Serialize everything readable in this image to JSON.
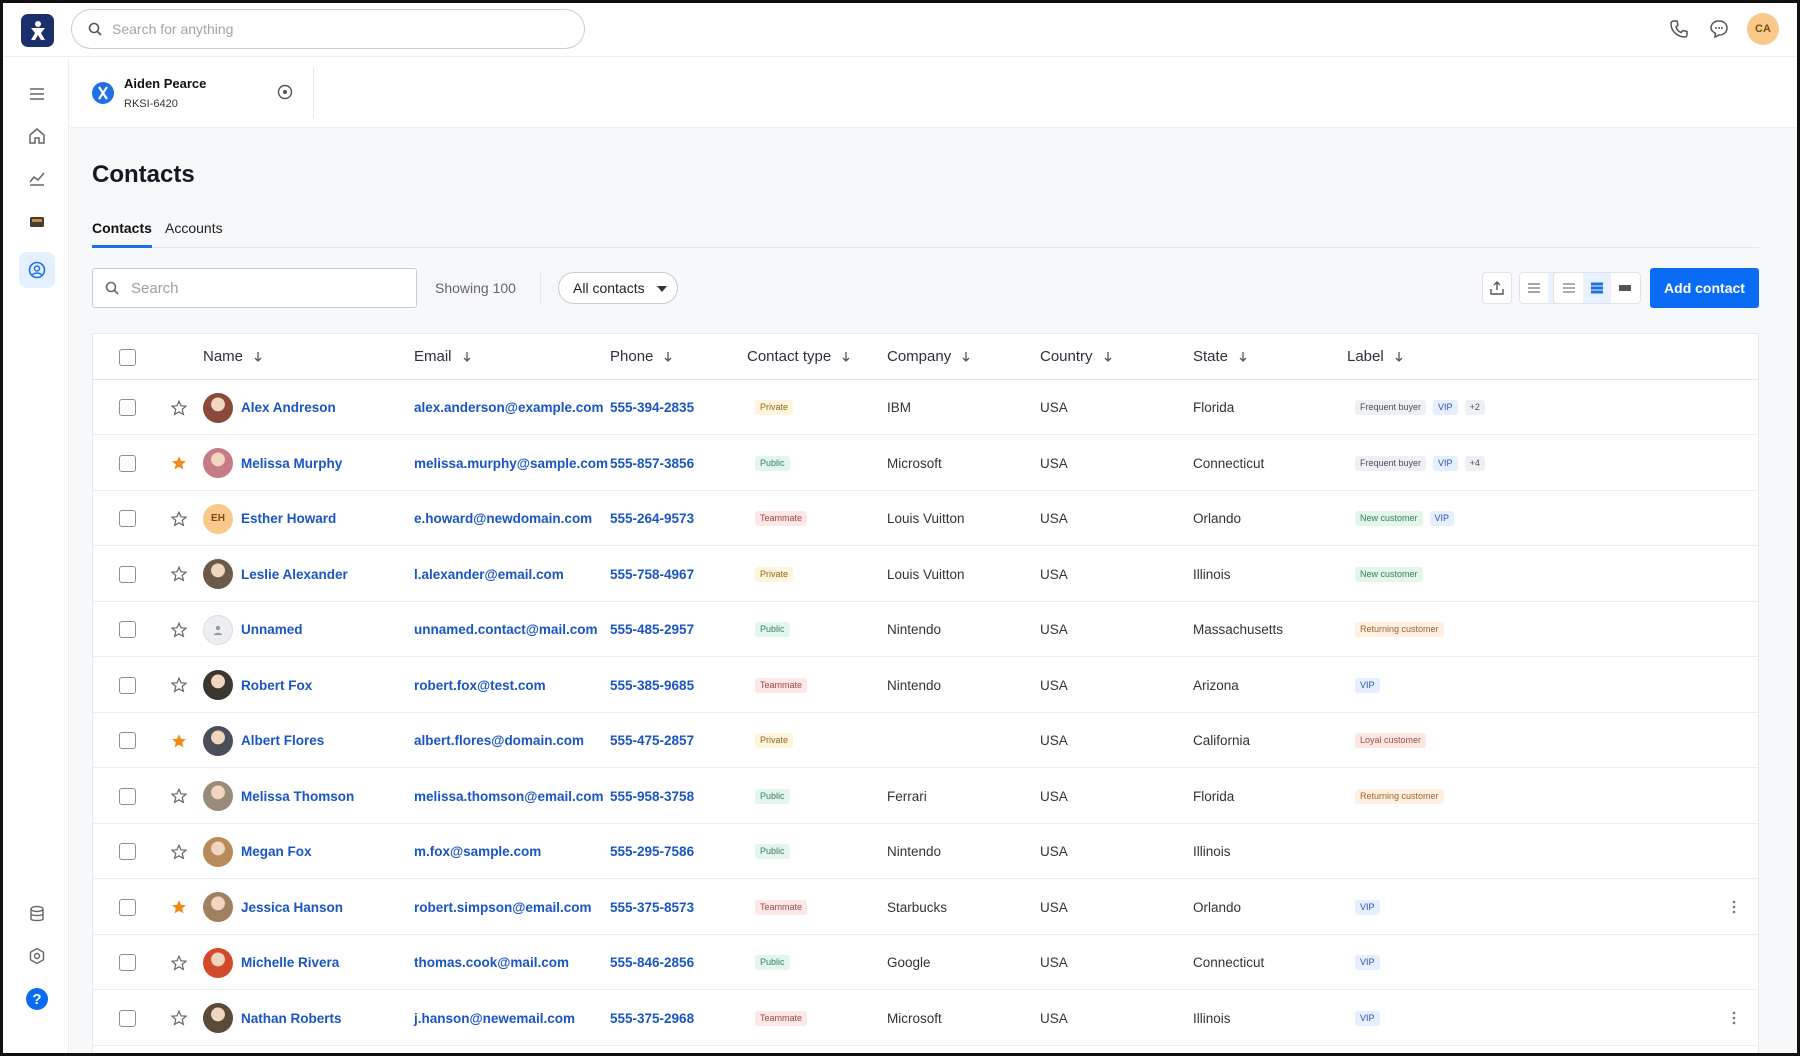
{
  "topbar": {
    "search_placeholder": "Search for anything",
    "user_initials": "CA"
  },
  "record": {
    "name": "Aiden Pearce",
    "id": "RKSI-6420"
  },
  "page": {
    "title": "Contacts",
    "tabs": [
      {
        "label": "Contacts",
        "active": true
      },
      {
        "label": "Accounts",
        "active": false
      }
    ]
  },
  "toolbar": {
    "search_placeholder": "Search",
    "showing": "Showing 100",
    "filter": "All contacts",
    "add_label": "Add contact"
  },
  "table": {
    "headers": [
      "Name",
      "Email",
      "Phone",
      "Contact type",
      "Company",
      "Country",
      "State",
      "Label"
    ],
    "rows": [
      {
        "starred": false,
        "avatar": "photo",
        "avatar_color": "#8a4a3a",
        "initials": "",
        "name": "Alex Andreson",
        "email": "alex.anderson@example.com",
        "phone": "555-394-2835",
        "type": "Private",
        "company": "IBM",
        "country": "USA",
        "state": "Florida",
        "labels": [
          {
            "text": "Frequent buyer",
            "style": "gray"
          },
          {
            "text": "VIP",
            "style": "vip"
          },
          {
            "text": "+2",
            "style": "gray"
          }
        ],
        "menu": false
      },
      {
        "starred": true,
        "avatar": "photo",
        "avatar_color": "#c77b86",
        "initials": "",
        "name": "Melissa Murphy",
        "email": "melissa.murphy@sample.com",
        "phone": "555-857-3856",
        "type": "Public",
        "company": "Microsoft",
        "country": "USA",
        "state": "Connecticut",
        "labels": [
          {
            "text": "Frequent buyer",
            "style": "gray"
          },
          {
            "text": "VIP",
            "style": "vip"
          },
          {
            "text": "+4",
            "style": "gray"
          }
        ],
        "menu": false
      },
      {
        "starred": false,
        "avatar": "initials",
        "avatar_color": "#f8c98b",
        "initials": "EH",
        "name": "Esther Howard",
        "email": "e.howard@newdomain.com",
        "phone": "555-264-9573",
        "type": "Teammate",
        "company": "Louis Vuitton",
        "country": "USA",
        "state": "Orlando",
        "labels": [
          {
            "text": "New customer",
            "style": "green"
          },
          {
            "text": "VIP",
            "style": "vip"
          }
        ],
        "menu": false
      },
      {
        "starred": false,
        "avatar": "photo",
        "avatar_color": "#6b5a4a",
        "initials": "",
        "name": "Leslie Alexander",
        "email": "l.alexander@email.com",
        "phone": "555-758-4967",
        "type": "Private",
        "company": "Louis Vuitton",
        "country": "USA",
        "state": "Illinois",
        "labels": [
          {
            "text": "New customer",
            "style": "green"
          }
        ],
        "menu": false
      },
      {
        "starred": false,
        "avatar": "placeholder",
        "avatar_color": "#eceef2",
        "initials": "",
        "name": "Unnamed",
        "email": "unnamed.contact@mail.com",
        "phone": "555-485-2957",
        "type": "Public",
        "company": "Nintendo",
        "country": "USA",
        "state": "Massachusetts",
        "labels": [
          {
            "text": "Returning customer",
            "style": "orange"
          }
        ],
        "menu": false
      },
      {
        "starred": false,
        "avatar": "photo",
        "avatar_color": "#3b3630",
        "initials": "",
        "name": "Robert Fox",
        "email": "robert.fox@test.com",
        "phone": "555-385-9685",
        "type": "Teammate",
        "company": "Nintendo",
        "country": "USA",
        "state": "Arizona",
        "labels": [
          {
            "text": "VIP",
            "style": "vip"
          }
        ],
        "menu": false
      },
      {
        "starred": true,
        "avatar": "photo",
        "avatar_color": "#4a4e58",
        "initials": "",
        "name": "Albert Flores",
        "email": "albert.flores@domain.com",
        "phone": "555-475-2857",
        "type": "Private",
        "company": "",
        "country": "USA",
        "state": "California",
        "labels": [
          {
            "text": "Loyal customer",
            "style": "red"
          }
        ],
        "menu": false
      },
      {
        "starred": false,
        "avatar": "photo",
        "avatar_color": "#9a8a7a",
        "initials": "",
        "name": "Melissa Thomson",
        "email": "melissa.thomson@email.com",
        "phone": "555-958-3758",
        "type": "Public",
        "company": "Ferrari",
        "country": "USA",
        "state": "Florida",
        "labels": [
          {
            "text": "Returning customer",
            "style": "orange"
          }
        ],
        "menu": false
      },
      {
        "starred": false,
        "avatar": "photo",
        "avatar_color": "#b98a5a",
        "initials": "",
        "name": "Megan Fox",
        "email": "m.fox@sample.com",
        "phone": "555-295-7586",
        "type": "Public",
        "company": "Nintendo",
        "country": "USA",
        "state": "Illinois",
        "labels": [],
        "menu": false
      },
      {
        "starred": true,
        "avatar": "photo",
        "avatar_color": "#a08060",
        "initials": "",
        "name": "Jessica Hanson",
        "email": "robert.simpson@email.com",
        "phone": "555-375-8573",
        "type": "Teammate",
        "company": "Starbucks",
        "country": "USA",
        "state": "Orlando",
        "labels": [
          {
            "text": "VIP",
            "style": "vip"
          }
        ],
        "menu": true
      },
      {
        "starred": false,
        "avatar": "photo",
        "avatar_color": "#d24a2a",
        "initials": "",
        "name": "Michelle Rivera",
        "email": "thomas.cook@mail.com",
        "phone": "555-846-2856",
        "type": "Public",
        "company": "Google",
        "country": "USA",
        "state": "Connecticut",
        "labels": [
          {
            "text": "VIP",
            "style": "vip"
          }
        ],
        "menu": false
      },
      {
        "starred": false,
        "avatar": "photo",
        "avatar_color": "#5a4a3a",
        "initials": "",
        "name": "Nathan Roberts",
        "email": "j.hanson@newemail.com",
        "phone": "555-375-2968",
        "type": "Teammate",
        "company": "Microsoft",
        "country": "USA",
        "state": "Illinois",
        "labels": [
          {
            "text": "VIP",
            "style": "vip"
          }
        ],
        "menu": true
      }
    ]
  },
  "colors": {
    "accent": "#0a6cf5",
    "link": "#1a55c4",
    "star": "#f08a1c",
    "brand_logo": "#1a2f6b"
  }
}
